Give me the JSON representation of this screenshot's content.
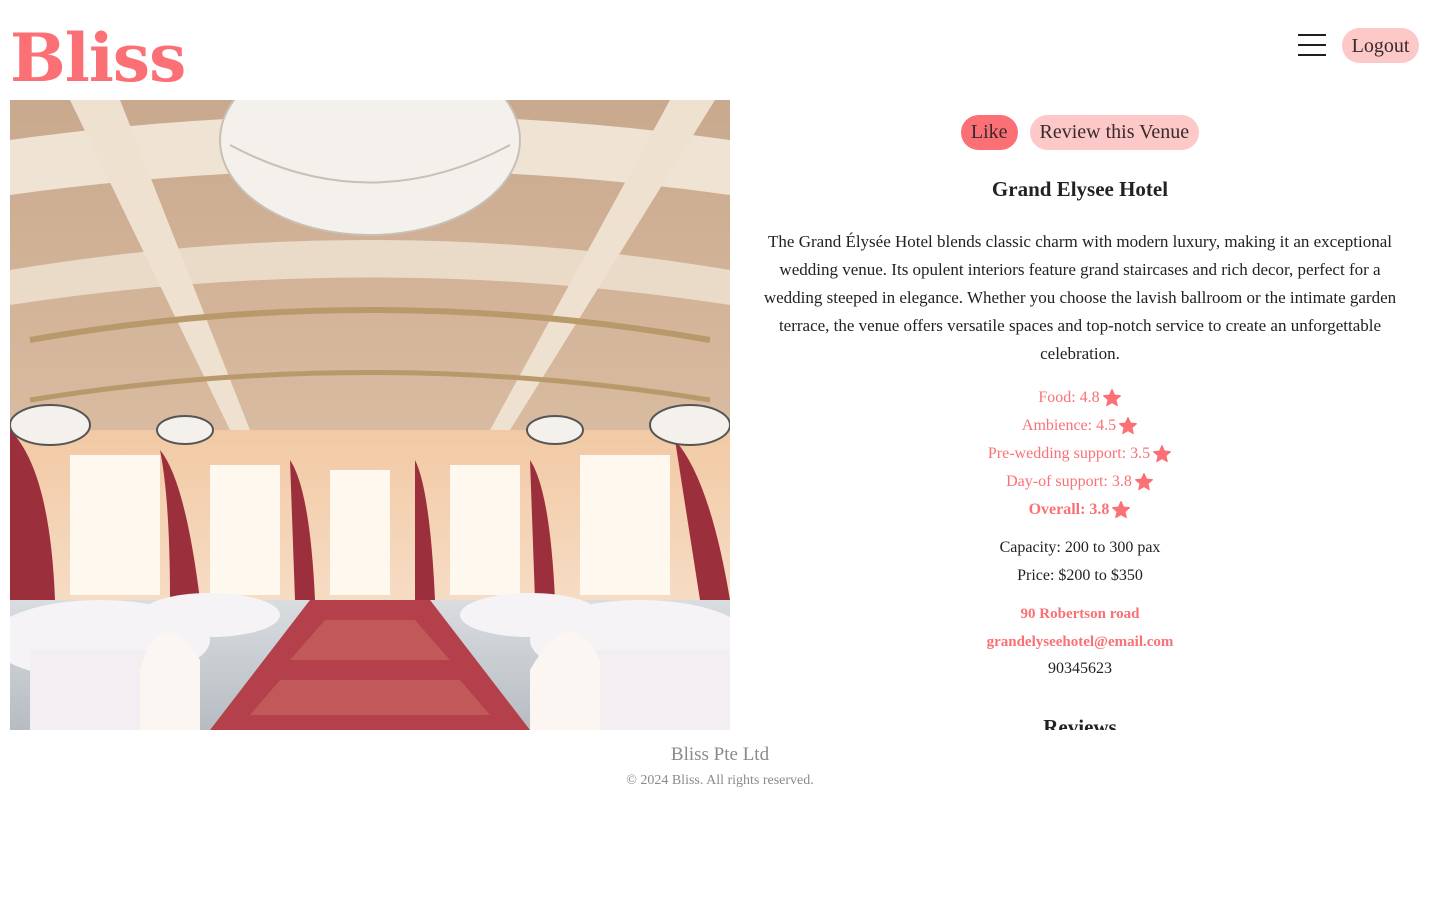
{
  "header": {
    "logo": "Bliss",
    "menu_icon": "hamburger-menu-icon",
    "logout_label": "Logout"
  },
  "actions": {
    "like_label": "Like",
    "review_label": "Review this Venue"
  },
  "venue": {
    "name": "Grand Elysee Hotel",
    "description": "The Grand Élysée Hotel blends classic charm with modern luxury, making it an exceptional wedding venue. Its opulent interiors feature grand staircases and rich decor, perfect for a wedding steeped in elegance. Whether you choose the lavish ballroom or the intimate garden terrace, the venue offers versatile spaces and top-notch service to create an unforgettable celebration.",
    "ratings": [
      {
        "label": "Food: 4.8",
        "value": 4.8
      },
      {
        "label": "Ambience: 4.5",
        "value": 4.5
      },
      {
        "label": "Pre-wedding support: 3.5",
        "value": 3.5
      },
      {
        "label": "Day-of support: 3.8",
        "value": 3.8
      },
      {
        "label": "Overall: 3.8",
        "value": 3.8
      }
    ],
    "rating_icon": "star-icon",
    "capacity": "Capacity: 200 to 300 pax",
    "price": "Price: $200 to $350",
    "address": "90 Robertson road",
    "email": "grandelyseehotel@email.com",
    "phone": "90345623"
  },
  "reviews": {
    "heading": "Reviews"
  },
  "footer": {
    "company": "Bliss Pte Ltd",
    "copyright": "© 2024 Bliss. All rights reserved."
  },
  "colors": {
    "brand": "#fb7075",
    "button_soft": "#fcc8c8",
    "footer_text": "#8a8a8a"
  }
}
